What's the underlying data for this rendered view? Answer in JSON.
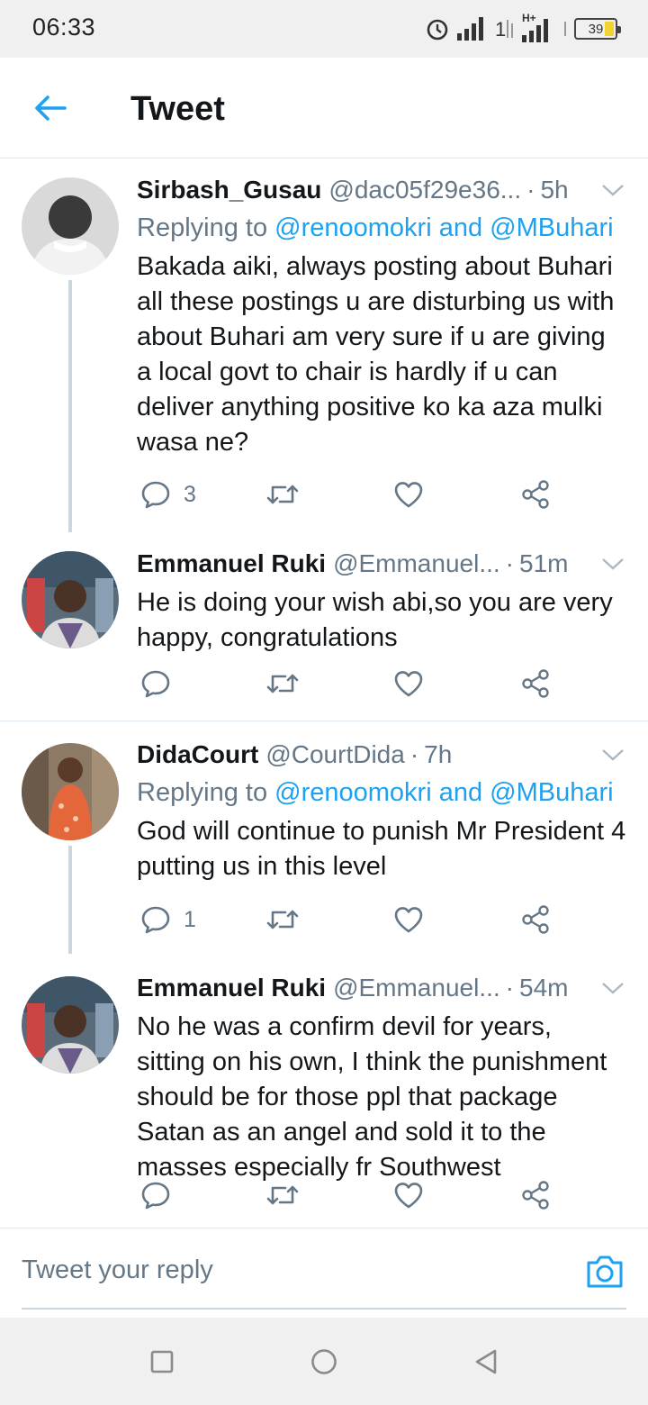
{
  "status_bar": {
    "time": "06:33",
    "network": "H+",
    "battery": "39"
  },
  "header": {
    "title": "Tweet"
  },
  "tweets": [
    {
      "name": "Sirbash_Gusau",
      "handle": "@dac05f29e36...",
      "separator": "·",
      "age": "5h",
      "replying_prefix": "Replying to",
      "replying_mentions": "@renoomokri and @MBuhari",
      "text": "Bakada aiki, always posting about Buhari all these postings u are disturbing us with about Buhari am very sure if u are giving a local govt to chair is hardly if u can deliver anything positive ko ka aza mulki wasa ne?",
      "reply_count": "3"
    },
    {
      "name": "Emmanuel Ruki",
      "handle": "@Emmanuel...",
      "separator": "·",
      "age": "51m",
      "text": "He is doing your wish abi,so you are very happy, congratulations",
      "reply_count": ""
    },
    {
      "name": "DidaCourt",
      "handle": "@CourtDida",
      "separator": "·",
      "age": "7h",
      "replying_prefix": "Replying to",
      "replying_mentions": "@renoomokri and @MBuhari",
      "text": "God will continue to punish Mr President 4 putting us in this level",
      "reply_count": "1"
    },
    {
      "name": "Emmanuel Ruki",
      "handle": "@Emmanuel...",
      "separator": "·",
      "age": "54m",
      "text": "No he was a confirm devil for years, sitting on his own, I think the punishment should be for those ppl that package Satan as an angel and sold it to the masses especially fr Southwest",
      "reply_count": ""
    }
  ],
  "composer": {
    "placeholder": "Tweet your reply"
  },
  "colors": {
    "accent": "#1da1f2",
    "secondary_text": "#657786",
    "divider": "#e1e8ed"
  },
  "icons": [
    "back-arrow-icon",
    "chevron-down-icon",
    "reply-icon",
    "retweet-icon",
    "like-icon",
    "share-icon",
    "camera-icon",
    "recent-apps-icon",
    "home-icon",
    "back-icon"
  ]
}
